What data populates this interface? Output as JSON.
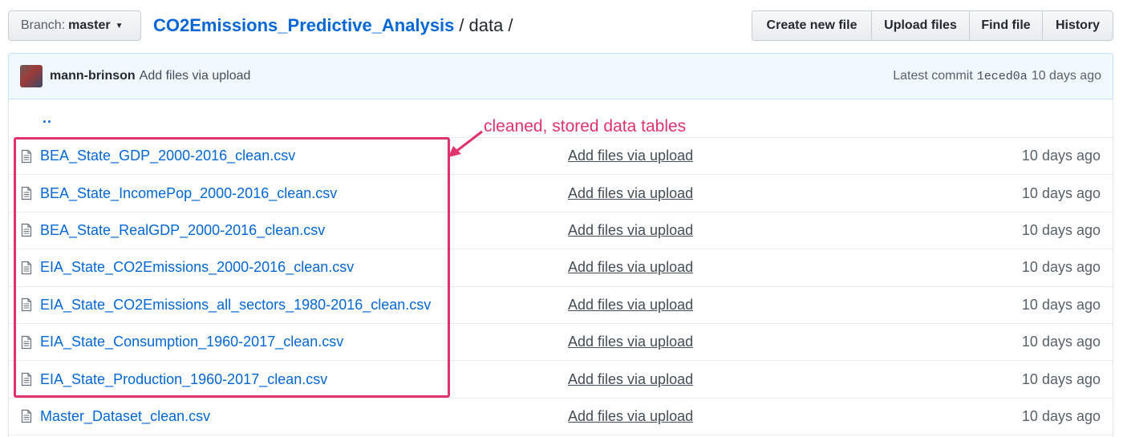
{
  "toolbar": {
    "branch_label": "Branch:",
    "branch_value": "master",
    "repo_name": "CO2Emissions_Predictive_Analysis",
    "separator": "/",
    "current_dir": "data",
    "trailing_sep": "/",
    "buttons": {
      "create": "Create new file",
      "upload": "Upload files",
      "find": "Find file",
      "history": "History"
    }
  },
  "commit": {
    "author": "mann-brinson",
    "message": "Add files via upload",
    "latest_label": "Latest commit",
    "sha": "1eced0a",
    "age": "10 days ago"
  },
  "parent_link": "..",
  "files": [
    {
      "name": "BEA_State_GDP_2000-2016_clean.csv",
      "message": "Add files via upload",
      "age": "10 days ago"
    },
    {
      "name": "BEA_State_IncomePop_2000-2016_clean.csv",
      "message": "Add files via upload",
      "age": "10 days ago"
    },
    {
      "name": "BEA_State_RealGDP_2000-2016_clean.csv",
      "message": "Add files via upload",
      "age": "10 days ago"
    },
    {
      "name": "EIA_State_CO2Emissions_2000-2016_clean.csv",
      "message": "Add files via upload",
      "age": "10 days ago"
    },
    {
      "name": "EIA_State_CO2Emissions_all_sectors_1980-2016_clean.csv",
      "message": "Add files via upload",
      "age": "10 days ago"
    },
    {
      "name": "EIA_State_Consumption_1960-2017_clean.csv",
      "message": "Add files via upload",
      "age": "10 days ago"
    },
    {
      "name": "EIA_State_Production_1960-2017_clean.csv",
      "message": "Add files via upload",
      "age": "10 days ago"
    },
    {
      "name": "Master_Dataset_clean.csv",
      "message": "Add files via upload",
      "age": "10 days ago"
    }
  ],
  "annotation": {
    "text": "cleaned, stored data tables",
    "color": "#e0336e"
  },
  "colors": {
    "link": "#0366d6",
    "commit_bar_bg": "#f1f8ff"
  }
}
